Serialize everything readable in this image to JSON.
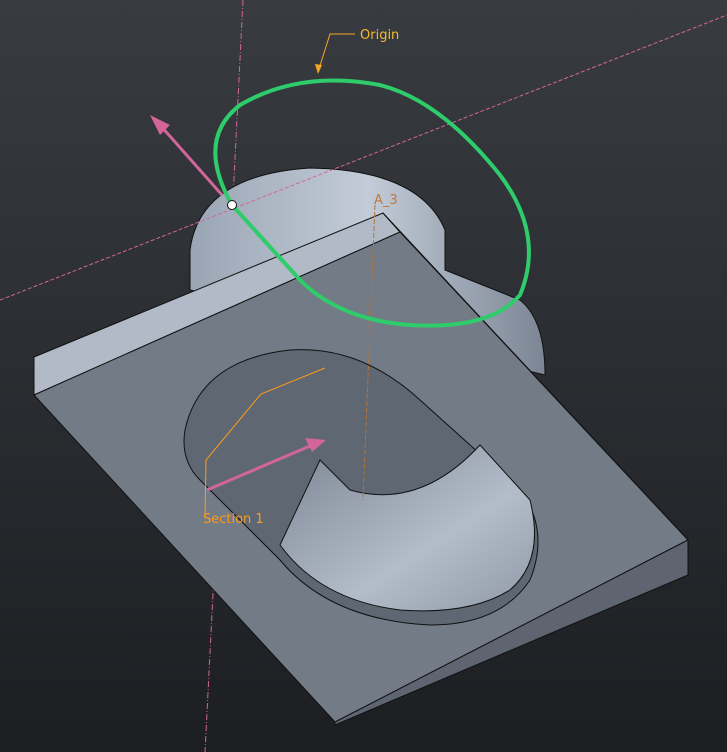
{
  "viewport": {
    "annotations": {
      "origin": "Origin",
      "axis": "A_3",
      "section": "Section 1"
    },
    "colors": {
      "sketch": "#2ecc6a",
      "datum": "#d2669a",
      "annotation": "#f5a623",
      "section": "#ff9a1a",
      "model": "#8a95a5"
    }
  }
}
